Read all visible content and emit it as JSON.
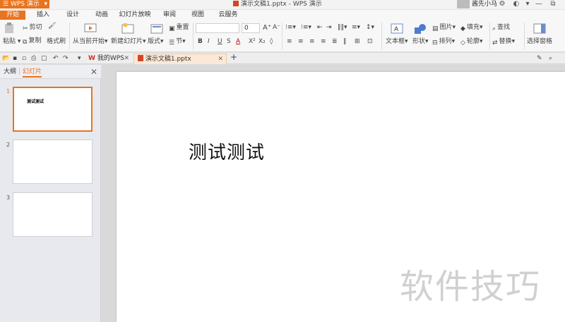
{
  "titlebar": {
    "app_label": "WPS 演示",
    "doc_title": "演示文稿1.pptx - WPS 演示",
    "user_name": "酱先小马"
  },
  "menu": {
    "tabs": [
      "开始",
      "插入",
      "设计",
      "动画",
      "幻灯片放映",
      "审阅",
      "视图",
      "云服务"
    ],
    "active": "开始"
  },
  "ribbon": {
    "paste": "粘贴",
    "cut": "剪切",
    "copy": "复制",
    "format_painter": "格式刷",
    "from_current": "从当前开始",
    "new_slide": "新建幻灯片",
    "layout": "版式",
    "reset": "重置",
    "section": "节",
    "font_size": "0",
    "text_box": "文本框",
    "shape": "形状",
    "picture": "图片",
    "fill": "填充",
    "arrange": "排列",
    "outline": "轮廓",
    "find": "查找",
    "replace": "替换",
    "select_pane": "选择窗格"
  },
  "tabstrip": {
    "my_wps": "我的WPS",
    "doc_tab": "演示文稿1.pptx"
  },
  "panel": {
    "tab_outline": "大纲",
    "tab_slides": "幻灯片",
    "slides": [
      {
        "num": "1",
        "text": "测试测试"
      },
      {
        "num": "2",
        "text": ""
      },
      {
        "num": "3",
        "text": ""
      }
    ]
  },
  "slide": {
    "text": "测试测试"
  },
  "watermark": "软件技巧",
  "colors": {
    "accent": "#e8741e",
    "ppt_red": "#d24625"
  }
}
